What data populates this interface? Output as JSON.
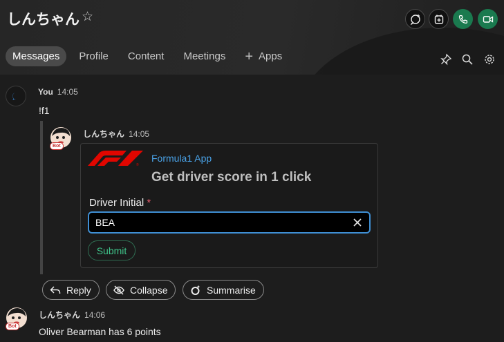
{
  "header": {
    "title": "しんちゃん",
    "star_icon": "star-outline-icon",
    "buttons": [
      "new-chat-icon",
      "add-calendar-icon",
      "phone-icon",
      "video-icon"
    ],
    "accent_green": "#1a7a4f"
  },
  "tabs": [
    {
      "label": "Messages",
      "active": true
    },
    {
      "label": "Profile"
    },
    {
      "label": "Content"
    },
    {
      "label": "Meetings"
    },
    {
      "label": "Apps",
      "icon": "plus-icon"
    }
  ],
  "toolbar_icons": [
    "pin-icon",
    "search-icon",
    "gear-icon"
  ],
  "messages": [
    {
      "sender": "You",
      "time": "14:05",
      "text": "!f1"
    },
    {
      "sender": "しんちゃん",
      "time": "14:05",
      "badge": "Bot"
    },
    {
      "sender": "しんちゃん",
      "time": "14:06",
      "badge": "Bot",
      "text": "Oliver Bearman has 6 points"
    }
  ],
  "card": {
    "app_name": "Formula1 App",
    "heading": "Get driver score in 1 click",
    "field_label": "Driver Initial",
    "required_mark": "*",
    "field_value": "BEA",
    "submit_label": "Submit",
    "accent_link": "#4aa3e8",
    "accent_submit": "#3fc48a"
  },
  "actions": {
    "reply": "Reply",
    "collapse": "Collapse",
    "summarise": "Summarise"
  }
}
